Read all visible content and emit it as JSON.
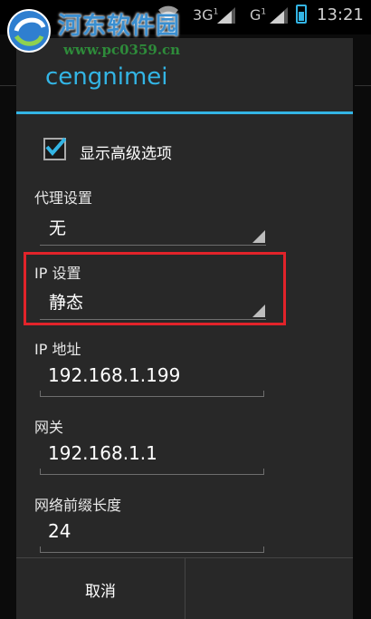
{
  "status_bar": {
    "time": "13:21",
    "network_1": "3G",
    "network_1_sub": "1",
    "network_2": "G",
    "network_2_sub": "1",
    "icons": [
      "signal-icon",
      "wifi-icon",
      "battery-icon"
    ]
  },
  "watermark": {
    "site_name": "河东软件园",
    "url": "www.pc0359.cn"
  },
  "dialog": {
    "title": "cengnimei",
    "show_advanced": {
      "label": "显示高级选项",
      "checked": true
    },
    "proxy": {
      "label": "代理设置",
      "value": "无"
    },
    "ip_settings": {
      "label": "IP 设置",
      "value": "静态"
    },
    "ip_address": {
      "label": "IP 地址",
      "value": "192.168.1.199"
    },
    "gateway": {
      "label": "网关",
      "value": "192.168.1.1"
    },
    "prefix_length": {
      "label": "网络前缀长度",
      "value": "24"
    },
    "buttons": {
      "cancel": "取消",
      "save": ""
    }
  },
  "colors": {
    "accent": "#33b5e5",
    "dialog_bg": "#282828",
    "highlight": "#e2232a"
  }
}
